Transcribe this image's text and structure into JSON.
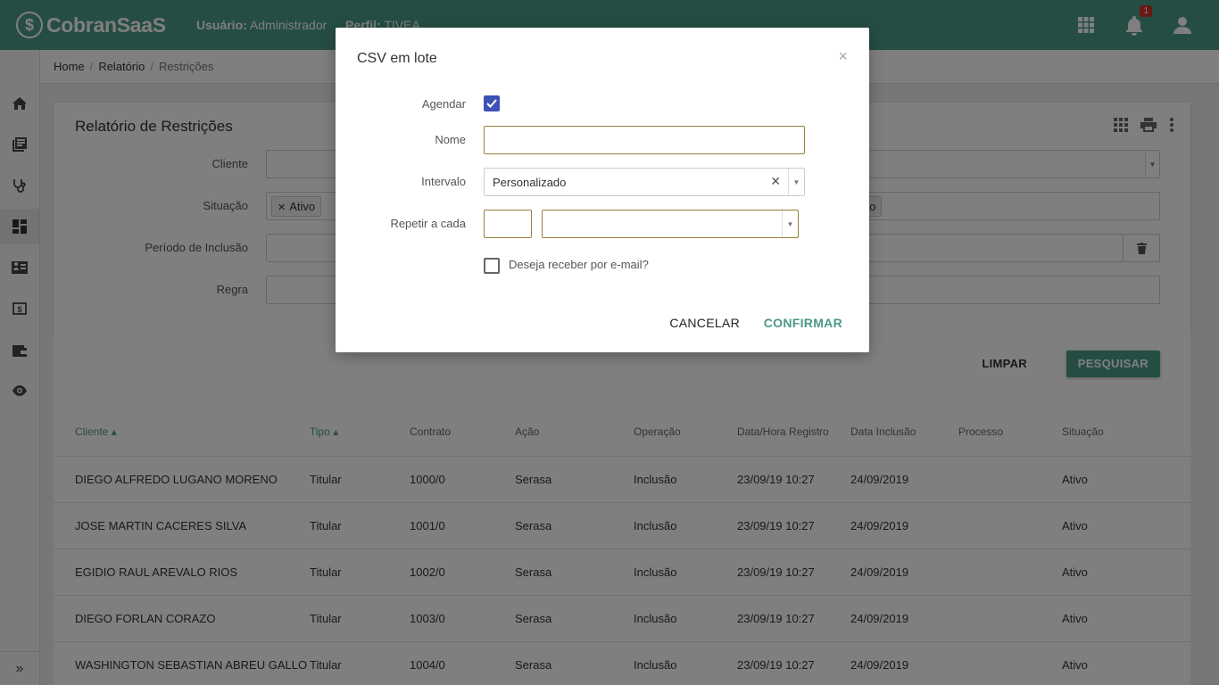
{
  "app": {
    "logo_mark": "$",
    "logo_text": "CobranSaaS"
  },
  "header": {
    "user_label": "Usuário:",
    "user_name": "Administrador",
    "profile_label": "Perfil:",
    "profile_name": "TIVEA",
    "notification_count": "1"
  },
  "sidebar": {
    "items": [
      {
        "icon": "home-icon"
      },
      {
        "icon": "library-icon"
      },
      {
        "icon": "stethoscope-icon"
      },
      {
        "icon": "dashboard-icon",
        "active": true
      },
      {
        "icon": "contact-card-icon"
      },
      {
        "icon": "money-icon"
      },
      {
        "icon": "wallet-icon"
      },
      {
        "icon": "eye-icon"
      }
    ],
    "expand_label": "»"
  },
  "breadcrumb": {
    "items": [
      "Home",
      "Relatório",
      "Restrições"
    ],
    "separator": "/"
  },
  "report": {
    "title": "Relatório de Restrições",
    "fields": {
      "cliente_label": "Cliente",
      "situacao_label": "Situação",
      "situacao_tag": "Ativo",
      "situacao_partial": "ão",
      "periodo_label": "Período de Inclusão",
      "regra_label": "Regra"
    },
    "clear_button": "LIMPAR",
    "search_button": "PESQUISAR"
  },
  "table": {
    "headers": [
      "Cliente",
      "Tipo",
      "Contrato",
      "Ação",
      "Operação",
      "Data/Hora Registro",
      "Data Inclusão",
      "Processo",
      "Situação"
    ],
    "rows": [
      [
        "DIEGO ALFREDO LUGANO MORENO",
        "Titular",
        "1000/0",
        "Serasa",
        "Inclusão",
        "23/09/19 10:27",
        "24/09/2019",
        "",
        "Ativo"
      ],
      [
        "JOSE MARTIN CACERES SILVA",
        "Titular",
        "1001/0",
        "Serasa",
        "Inclusão",
        "23/09/19 10:27",
        "24/09/2019",
        "",
        "Ativo"
      ],
      [
        "EGIDIO RAUL AREVALO RIOS",
        "Titular",
        "1002/0",
        "Serasa",
        "Inclusão",
        "23/09/19 10:27",
        "24/09/2019",
        "",
        "Ativo"
      ],
      [
        "DIEGO FORLAN CORAZO",
        "Titular",
        "1003/0",
        "Serasa",
        "Inclusão",
        "23/09/19 10:27",
        "24/09/2019",
        "",
        "Ativo"
      ],
      [
        "WASHINGTON SEBASTIAN ABREU GALLO",
        "Titular",
        "1004/0",
        "Serasa",
        "Inclusão",
        "23/09/19 10:27",
        "24/09/2019",
        "",
        "Ativo"
      ]
    ]
  },
  "modal": {
    "title": "CSV em lote",
    "close": "×",
    "agendar_label": "Agendar",
    "agendar_checked": true,
    "nome_label": "Nome",
    "nome_value": "",
    "intervalo_label": "Intervalo",
    "intervalo_value": "Personalizado",
    "repetir_label": "Repetir a cada",
    "repetir_number": "",
    "repetir_unit": "",
    "email_label": "Deseja receber por e-mail?",
    "email_checked": false,
    "cancel_button": "CANCELAR",
    "confirm_button": "CONFIRMAR"
  },
  "colors": {
    "primary": "#4a9a88",
    "checkbox": "#3f51b5",
    "badge": "#d32f2f",
    "input_focus": "#9a7d3a"
  }
}
